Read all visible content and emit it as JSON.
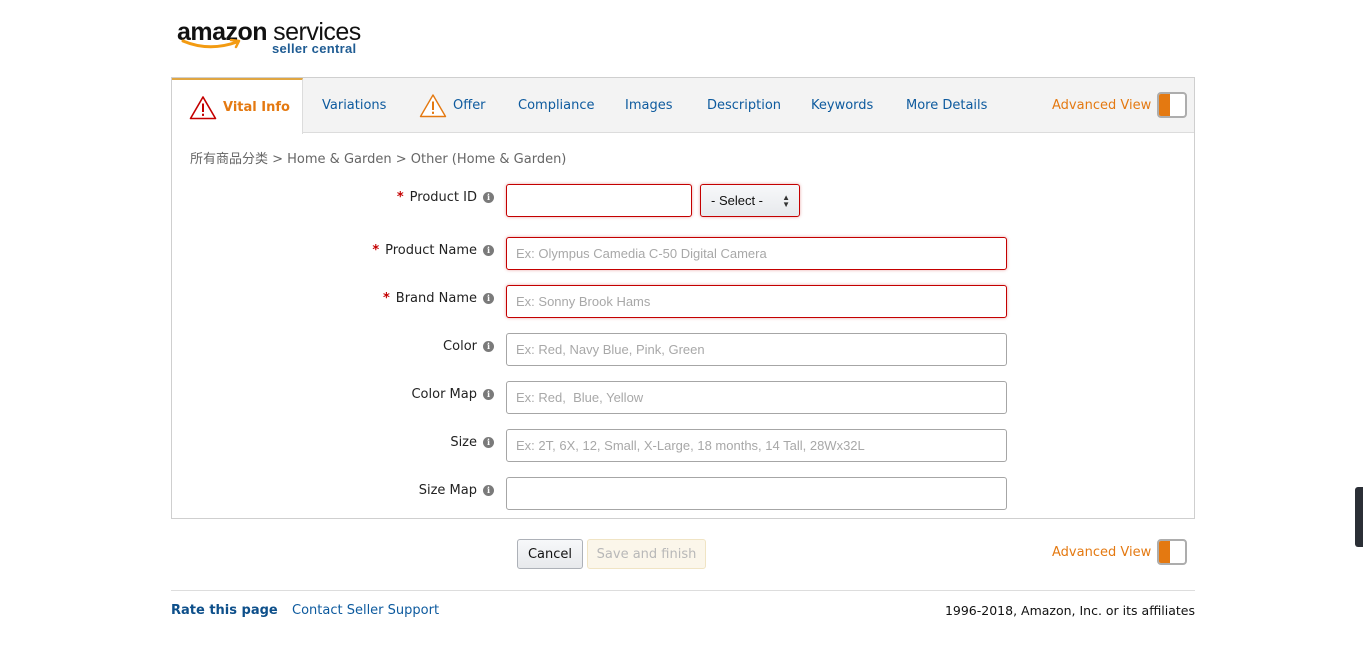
{
  "logo": {
    "brand": "amazon",
    "services": "services",
    "sub": "seller central"
  },
  "tabs": [
    {
      "label": "Vital Info",
      "warning": true,
      "active": true
    },
    {
      "label": "Variations",
      "warning": false,
      "active": false
    },
    {
      "label": "Offer",
      "warning": true,
      "active": false
    },
    {
      "label": "Compliance",
      "warning": false,
      "active": false
    },
    {
      "label": "Images",
      "warning": false,
      "active": false
    },
    {
      "label": "Description",
      "warning": false,
      "active": false
    },
    {
      "label": "Keywords",
      "warning": false,
      "active": false
    },
    {
      "label": "More Details",
      "warning": false,
      "active": false
    }
  ],
  "advanced_view": {
    "label": "Advanced View",
    "enabled": true
  },
  "breadcrumb": "所有商品分类 > Home & Garden > Other (Home & Garden)",
  "form": {
    "product_id": {
      "label": "Product ID",
      "required": true,
      "value": "",
      "select_value": "- Select -"
    },
    "product_name": {
      "label": "Product Name",
      "required": true,
      "placeholder": "Ex: Olympus Camedia C-50 Digital Camera"
    },
    "brand_name": {
      "label": "Brand Name",
      "required": true,
      "placeholder": "Ex: Sonny Brook Hams"
    },
    "color": {
      "label": "Color",
      "required": false,
      "placeholder": "Ex: Red, Navy Blue, Pink, Green"
    },
    "color_map": {
      "label": "Color Map",
      "required": false,
      "placeholder": "Ex: Red,  Blue, Yellow"
    },
    "size": {
      "label": "Size",
      "required": false,
      "placeholder": "Ex: 2T, 6X, 12, Small, X-Large, 18 months, 14 Tall, 28Wx32L"
    },
    "size_map": {
      "label": "Size Map",
      "required": false,
      "placeholder": ""
    }
  },
  "buttons": {
    "cancel": "Cancel",
    "save_finish": "Save and finish"
  },
  "footer": {
    "rate": "Rate this page",
    "contact": "Contact Seller Support",
    "copyright": "1996-2018, Amazon, Inc. or its affiliates"
  },
  "colors": {
    "accent": "#e47911",
    "link": "#0d5a9e",
    "error": "#c40000"
  }
}
